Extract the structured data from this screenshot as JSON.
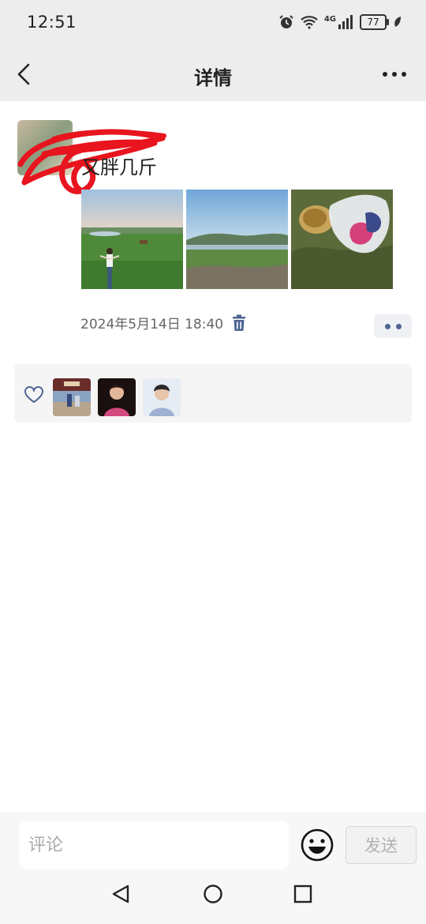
{
  "status_bar": {
    "time": "12:51",
    "network": "4G",
    "battery": "77",
    "icons": [
      "alarm-icon",
      "wifi-icon",
      "signal-icon",
      "battery-icon",
      "leaf-icon"
    ]
  },
  "nav": {
    "title": "详情",
    "back_icon": "chevron-left-icon",
    "more_icon": "ellipsis-icon"
  },
  "post": {
    "text": "又胖几斤",
    "timestamp": "2024年5月14日 18:40",
    "photos": [
      "field-person-photo",
      "river-landscape-photo",
      "bag-on-grass-photo"
    ],
    "likers": [
      "liker-1",
      "liker-2",
      "liker-3"
    ]
  },
  "comment_bar": {
    "placeholder": "评论",
    "send_label": "发送"
  },
  "colors": {
    "accent": "#4f6591",
    "nav_bg": "#ededed",
    "scribble": "#e8141e"
  }
}
